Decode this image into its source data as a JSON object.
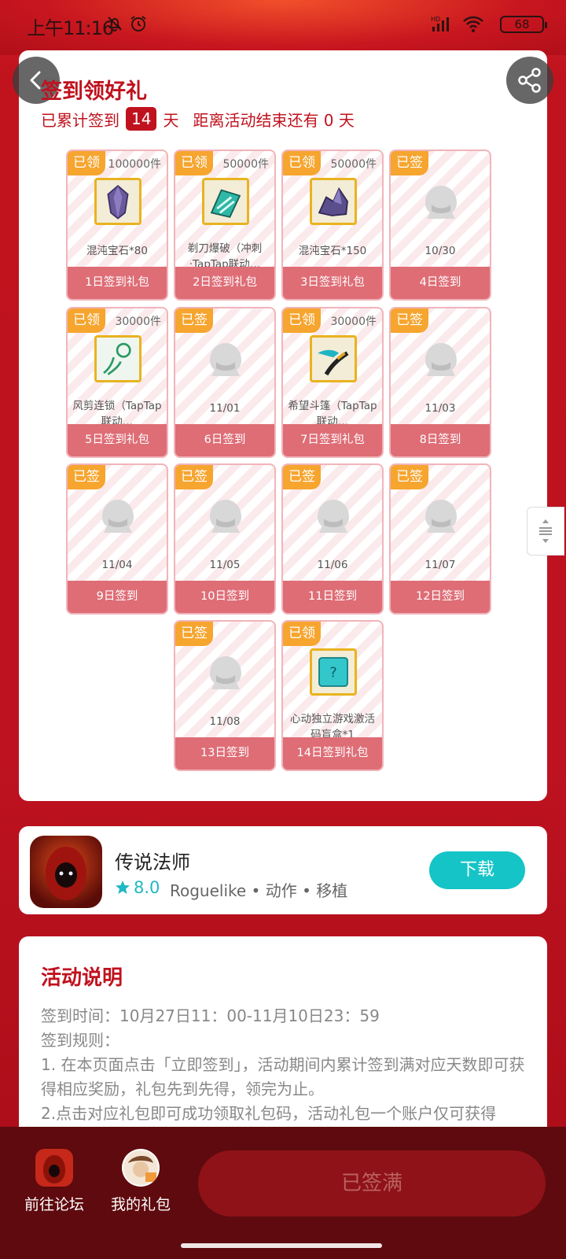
{
  "status_bar": {
    "time": "上午11:16",
    "battery": "68"
  },
  "header": {
    "title": "签到领好礼",
    "cum_prefix": "已累计签到",
    "cum_days": "14",
    "cum_unit": "天",
    "remain_text": "距离活动结束还有 0 天"
  },
  "grid": [
    {
      "badge": "已领",
      "stock": "100000件",
      "name": "混沌宝石*80",
      "footer": "1日签到礼包",
      "icon": "purple-gem-icon"
    },
    {
      "badge": "已领",
      "stock": "50000件",
      "name": "剃刀爆破（冲刺·TapTap联动…",
      "footer": "2日签到礼包",
      "icon": "teal-blade-icon"
    },
    {
      "badge": "已领",
      "stock": "50000件",
      "name": "混沌宝石*150",
      "footer": "3日签到礼包",
      "icon": "purple-crystal-icon"
    },
    {
      "badge": "已签",
      "stock": "",
      "name": "10/30",
      "footer": "4日签到",
      "icon": "placeholder-icon"
    },
    {
      "badge": "已领",
      "stock": "30000件",
      "name": "风剪连锁（TapTap联动…",
      "footer": "5日签到礼包",
      "icon": "wind-scissors-icon"
    },
    {
      "badge": "已签",
      "stock": "",
      "name": "11/01",
      "footer": "6日签到",
      "icon": "placeholder-icon"
    },
    {
      "badge": "已领",
      "stock": "30000件",
      "name": "希望斗篷（TapTap联动…",
      "footer": "7日签到礼包",
      "icon": "hope-cloak-icon"
    },
    {
      "badge": "已签",
      "stock": "",
      "name": "11/03",
      "footer": "8日签到",
      "icon": "placeholder-icon"
    },
    {
      "badge": "已签",
      "stock": "",
      "name": "11/04",
      "footer": "9日签到",
      "icon": "placeholder-icon"
    },
    {
      "badge": "已签",
      "stock": "",
      "name": "11/05",
      "footer": "10日签到",
      "icon": "placeholder-icon"
    },
    {
      "badge": "已签",
      "stock": "",
      "name": "11/06",
      "footer": "11日签到",
      "icon": "placeholder-icon"
    },
    {
      "badge": "已签",
      "stock": "",
      "name": "11/07",
      "footer": "12日签到",
      "icon": "placeholder-icon"
    },
    {
      "badge": "已签",
      "stock": "",
      "name": "11/08",
      "footer": "13日签到",
      "icon": "placeholder-icon"
    },
    {
      "badge": "已领",
      "stock": "",
      "name": "心动独立游戏激活码盲盒*1",
      "footer": "14日签到礼包",
      "icon": "blind-box-icon"
    }
  ],
  "game": {
    "name": "传说法师",
    "rating": "8.0",
    "tags": "Roguelike • 动作 • 移植",
    "download_label": "下载"
  },
  "description": {
    "title": "活动说明",
    "lines": [
      "签到时间：10月27日11：00-11月10日23：59",
      "签到规则：",
      "1. 在本页面点击「立即签到」，活动期间内累计签到满对应天数即可获得相应奖励，礼包先到先得，领完为止。",
      "2.点击对应礼包即可成功领取礼包码，活动礼包一个账户仅可获得"
    ]
  },
  "bottom": {
    "forum_label": "前往论坛",
    "gift_label": "我的礼包",
    "signed_label": "已签满"
  },
  "colors": {
    "accent": "#c0121e",
    "badge": "#f6a52f",
    "cell_footer": "#de6d76",
    "download": "#15c4c6"
  }
}
